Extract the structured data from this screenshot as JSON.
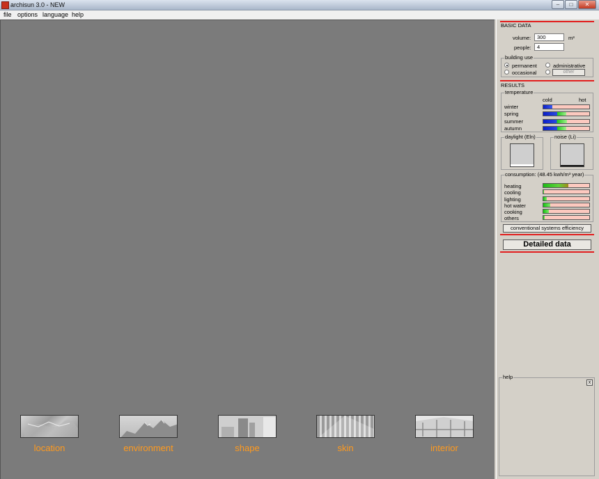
{
  "window": {
    "title": "archisun 3.0 - NEW",
    "min_icon": "minimize-icon",
    "max_icon": "maximize-icon",
    "close_icon": "close-icon"
  },
  "menu": [
    "file",
    "options",
    "language",
    "help"
  ],
  "thumbnails": [
    {
      "label": "location",
      "icon": "map-thumbnail"
    },
    {
      "label": "environment",
      "icon": "mountain-thumbnail"
    },
    {
      "label": "shape",
      "icon": "buildings-thumbnail"
    },
    {
      "label": "skin",
      "icon": "facade-thumbnail"
    },
    {
      "label": "interior",
      "icon": "room-thumbnail"
    }
  ],
  "basic_data": {
    "title": "BASIC DATA",
    "volume_label": "volume:",
    "volume_value": "300",
    "volume_unit": "m³",
    "people_label": "people:",
    "people_value": "4"
  },
  "building_use": {
    "title": "building use",
    "options": [
      "permanent",
      "administrative",
      "occasional",
      "other"
    ],
    "selected": "permanent"
  },
  "results": {
    "title": "RESULTS",
    "temperature": {
      "title": "temperature",
      "cold": "cold",
      "hot": "hot",
      "seasons": [
        {
          "label": "winter",
          "level": 0.2,
          "green": 0.0
        },
        {
          "label": "spring",
          "level": 0.3,
          "green": 0.2
        },
        {
          "label": "summer",
          "level": 0.3,
          "green": 0.22
        },
        {
          "label": "autumn",
          "level": 0.3,
          "green": 0.2
        }
      ]
    },
    "daylight": {
      "title": "daylight (Eln)",
      "level": 0.1
    },
    "noise": {
      "title": "noise (Li)",
      "level": 0.06
    },
    "consumption": {
      "title": "consumption: (48.45 kwh/m³ year)",
      "items": [
        {
          "label": "heating",
          "level": 0.55
        },
        {
          "label": "cooling",
          "level": 0.02
        },
        {
          "label": "lighting",
          "level": 0.08
        },
        {
          "label": "hot water",
          "level": 0.15
        },
        {
          "label": "cooking",
          "level": 0.12
        },
        {
          "label": "others",
          "level": 0.03
        }
      ]
    },
    "efficiency_button": "conventional systems efficiency"
  },
  "detailed_button": "Detailed data",
  "help": {
    "title": "help",
    "close": "x"
  }
}
